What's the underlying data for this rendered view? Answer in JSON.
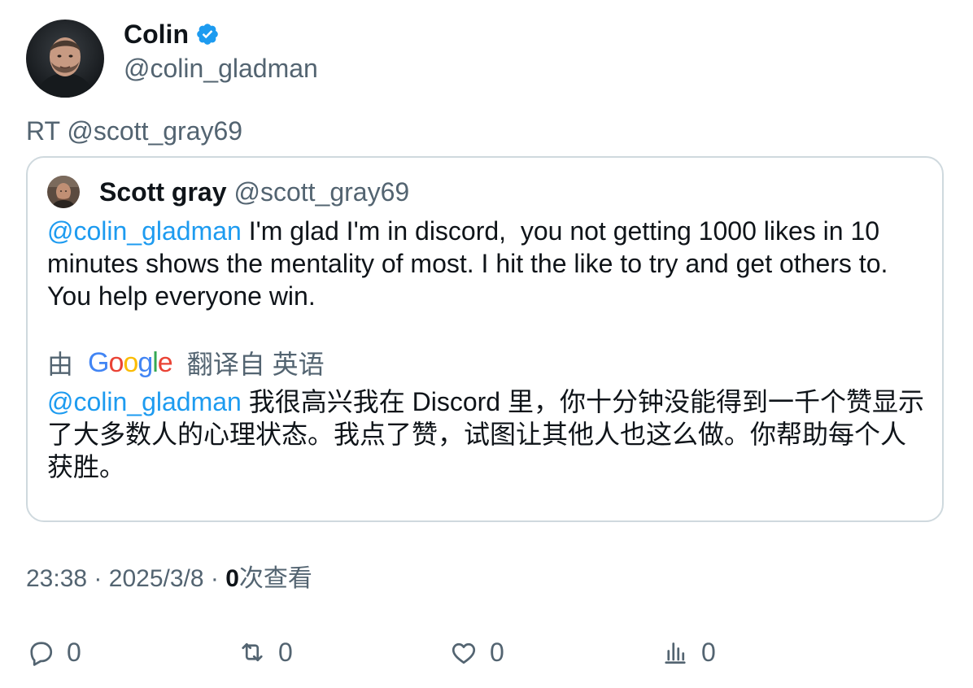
{
  "author": {
    "display_name": "Colin",
    "handle": "@colin_gladman",
    "verified_icon": "verified-badge-icon",
    "accent_color": "#1d9bf0"
  },
  "retweet_line": "RT @scott_gray69",
  "quoted": {
    "display_name": "Scott gray",
    "handle": "@scott_gray69",
    "mention": "@colin_gladman",
    "text": " I'm glad I'm in discord,  you not getting 1000 likes in 10 minutes shows the mentality of most. I hit the like to try and get others to. You help everyone win.",
    "translation": {
      "prefix": "由",
      "logo": "Google",
      "suffix": "翻译自 英语",
      "mention": "@colin_gladman",
      "text": " 我很高兴我在 Discord 里，你十分钟没能得到一千个赞显示了大多数人的心理状态。我点了赞，试图让其他人也这么做。你帮助每个人获胜。"
    }
  },
  "meta": {
    "time": "23:38",
    "date": "2025/3/8",
    "separator": "·",
    "views_count": "0",
    "views_label": "次查看"
  },
  "actions": {
    "reply_count": "0",
    "retweet_count": "0",
    "like_count": "0",
    "views_count": "0"
  }
}
